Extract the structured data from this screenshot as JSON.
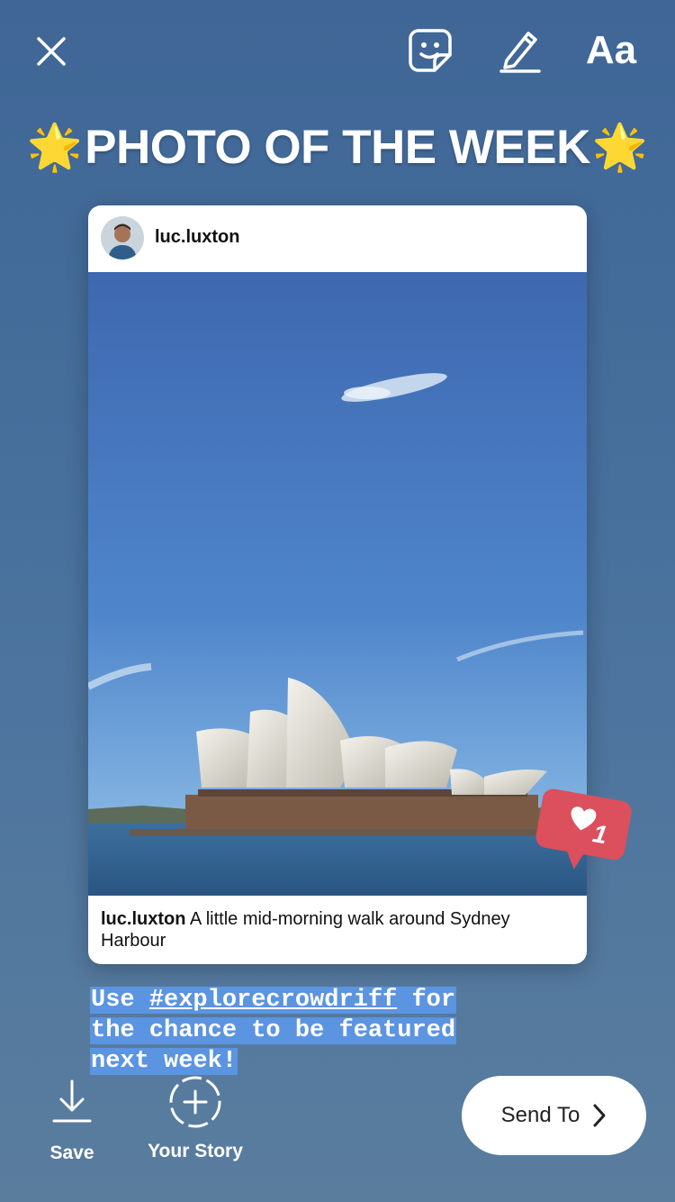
{
  "toolbar": {
    "close_icon": "close-icon",
    "sticker_icon": "sticker-icon",
    "draw_icon": "pen-icon",
    "text_tool_label": "Aa"
  },
  "headline": {
    "star_left": "🌟",
    "title": "PHOTO OF THE WEEK",
    "star_right": "🌟"
  },
  "post": {
    "username": "luc.luxton",
    "caption_user": "luc.luxton",
    "caption_text": "A little mid-morning walk around Sydney Harbour"
  },
  "like_sticker": {
    "count": "1",
    "color": "#dc4f5c"
  },
  "overlay_text": {
    "line1_prefix": "Use ",
    "hashtag": "#explorecrowdriff",
    "line1_suffix": " for",
    "line2": "the chance to be featured",
    "line3": "next week!",
    "highlight_color": "#5b94e0"
  },
  "bottom": {
    "save_label": "Save",
    "your_story_label": "Your Story",
    "send_to_label": "Send To"
  }
}
